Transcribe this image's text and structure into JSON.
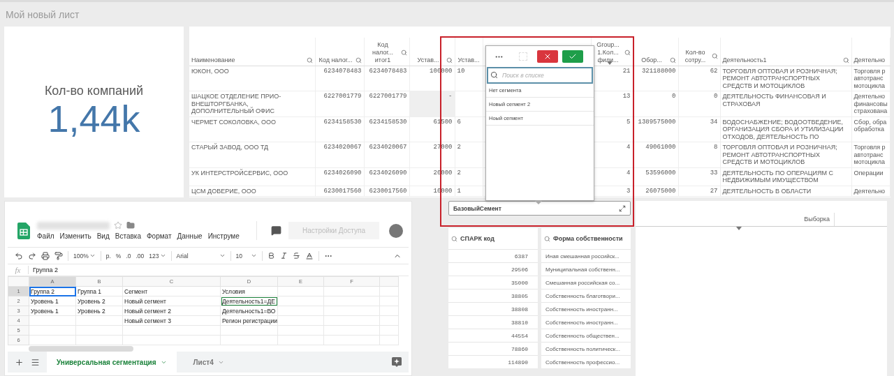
{
  "page_title": "Мой новый лист",
  "kpi": {
    "label": "Кол-во компаний",
    "value": "1,44k"
  },
  "table": {
    "columns": [
      {
        "label": "Наименование",
        "kind": "text",
        "searchable": true,
        "sorted": false
      },
      {
        "label": "Код налог...",
        "kind": "number",
        "searchable": true,
        "sorted": false
      },
      {
        "label": "Код налог... итог1",
        "kind": "number",
        "searchable": true,
        "sorted": false
      },
      {
        "label": "Устав...",
        "kind": "number",
        "searchable": true,
        "sorted": false
      },
      {
        "label": "Устав...",
        "kind": "cut",
        "searchable": false,
        "sorted": false
      },
      {
        "label": "Group... 1.Кол... фили...",
        "kind": "number",
        "searchable": true,
        "sorted": true
      },
      {
        "label": "Обор...",
        "kind": "number",
        "searchable": true,
        "sorted": false
      },
      {
        "label": "Кол-во сотру...",
        "kind": "number",
        "searchable": true,
        "sorted": false
      },
      {
        "label": "Деятельность1",
        "kind": "text",
        "searchable": true,
        "sorted": false
      },
      {
        "label": "Деятельно",
        "kind": "text",
        "searchable": false,
        "sorted": false
      }
    ],
    "rows": [
      [
        "ЮКОН, ООО",
        "6234078483",
        "6234078483",
        "100000",
        "10",
        "21",
        "321188000",
        "62",
        "ТОРГОВЛЯ ОПТОВАЯ И РОЗНИЧНАЯ; РЕМОНТ АВТОТРАНСПОРТНЫХ СРЕДСТВ И МОТОЦИКЛОВ",
        "Торговля р автотранс мотоцикла"
      ],
      [
        "ШАЦКОЕ ОТДЕЛЕНИЕ ПРИО-ВНЕШТОРГБАНКА, ДОПОЛНИТЕЛЬНЫЙ ОФИС",
        "6227001779",
        "6227001779",
        {
          "text": "-",
          "missing": true
        },
        null,
        "13",
        "0",
        "0",
        "ДЕЯТЕЛЬНОСТЬ ФИНАНСОВАЯ И СТРАХОВАЯ",
        "Деятельно финансовы страхована"
      ],
      [
        "ЧЕРМЕТ СОКОЛОВКА, ООО",
        "6234158530",
        "6234158530",
        "61500",
        "6",
        "5",
        "1389575000",
        "34",
        "ВОДОСНАБЖЕНИЕ; ВОДООТВЕДЕНИЕ, ОРГАНИЗАЦИЯ СБОРА И УТИЛИЗАЦИИ ОТХОДОВ, ДЕЯТЕЛЬНОСТЬ ПО",
        "Сбор, обра обработка"
      ],
      [
        "СТАРЫЙ ЗАВОД, ООО ТД",
        "6234020067",
        "6234020067",
        "27000",
        "2",
        "4",
        "49061000",
        "8",
        "ТОРГОВЛЯ ОПТОВАЯ И РОЗНИЧНАЯ; РЕМОНТ АВТОТРАНСПОРТНЫХ СРЕДСТВ И МОТОЦИКЛОВ",
        "Торговля р автотранс мотоцикла"
      ],
      [
        "УК ИНТЕРСТРОЙСЕРВИС, ООО",
        "6234026090",
        "6234026090",
        "20000",
        "2",
        "4",
        "53596000",
        "33",
        "ДЕЯТЕЛЬНОСТЬ ПО ОПЕРАЦИЯМ С НЕДВИЖИМЫМ ИМУЩЕСТВОМ",
        "Операции"
      ],
      [
        "ЦСМ ДОВЕРИЕ, ООО",
        "6230017560",
        "6230017560",
        "10000",
        "1",
        "3",
        "26075000",
        "27",
        "ДЕЯТЕЛЬНОСТЬ В ОБЛАСТИ",
        "Деятельно"
      ]
    ]
  },
  "popup": {
    "selection_tool_disabled": true,
    "search_placeholder": "Поиск в списке",
    "items": [
      "Нет сегмента",
      "Новый сегмент 2",
      "Ноый сегмент"
    ]
  },
  "filter_box": {
    "title": "БазовыйСемент"
  },
  "lists": [
    {
      "title": "СПАРК код",
      "kind": "number",
      "values": [
        "6387",
        "29506",
        "35000",
        "38805",
        "38808",
        "38810",
        "44554",
        "78860",
        "114890"
      ]
    },
    {
      "title": "Форма собственности",
      "kind": "text",
      "values": [
        "Иная смешанная российск...",
        "Муниципальная собственн...",
        "Смешанная российская со...",
        "Собственность благотвори...",
        "Собственность иностранн...",
        "Собственность иностранн...",
        "Собственность обществен...",
        "Собственность политическ...",
        "Собственность профессио..."
      ]
    }
  ],
  "selection_panel": {
    "header": "Выборка",
    "sort_indicator": true
  },
  "spreadsheet": {
    "menu": [
      "Файл",
      "Изменить",
      "Вид",
      "Вставка",
      "Формат",
      "Данные",
      "Инструме"
    ],
    "share_button": "Настройки Доступа",
    "toolbar": {
      "zoom": "100%",
      "currency": "р.",
      "percent": "%",
      "decrease_decimals": ".0",
      "increase_decimals": ".00",
      "number_format": "123",
      "font": "Arial",
      "font_size": "10"
    },
    "formula_label": "fx",
    "formula": "Группа 2",
    "columns": [
      "A",
      "B",
      "C",
      "D",
      "E",
      "F"
    ],
    "rows": [
      {
        "number": "1",
        "cells": [
          {
            "text": "Группа 2",
            "selected": true,
            "collaborator": false
          },
          {
            "text": "Группа 1",
            "selected": false,
            "collaborator": false
          },
          {
            "text": "Сегмент",
            "selected": false,
            "collaborator": false
          },
          {
            "text": "Условия",
            "selected": false,
            "collaborator": false
          }
        ]
      },
      {
        "number": "2",
        "cells": [
          {
            "text": "Уровень 1",
            "selected": false,
            "collaborator": false
          },
          {
            "text": "Уровень 2",
            "selected": false,
            "collaborator": false
          },
          {
            "text": "Новый сегмент",
            "selected": false,
            "collaborator": false
          },
          {
            "text": "Деятельность1=ДЕ",
            "selected": false,
            "collaborator": true
          }
        ]
      },
      {
        "number": "3",
        "cells": [
          {
            "text": "Уровень 1",
            "selected": false,
            "collaborator": false
          },
          {
            "text": "Уровень 2",
            "selected": false,
            "collaborator": false
          },
          {
            "text": "Новый сегмент 2",
            "selected": false,
            "collaborator": false
          },
          {
            "text": "Деятельность1=ВО",
            "selected": false,
            "collaborator": false
          }
        ]
      },
      {
        "number": "4",
        "cells": [
          null,
          null,
          {
            "text": "Новый сегмент 3",
            "selected": false,
            "collaborator": false
          },
          {
            "text": "Регион регистрации",
            "selected": false,
            "collaborator": false
          }
        ]
      },
      {
        "number": "5"
      },
      {
        "number": "6"
      }
    ],
    "tabs": [
      {
        "label": "Универсальная сегментация",
        "selected": true
      },
      {
        "label": "Лист4",
        "selected": false
      }
    ]
  }
}
